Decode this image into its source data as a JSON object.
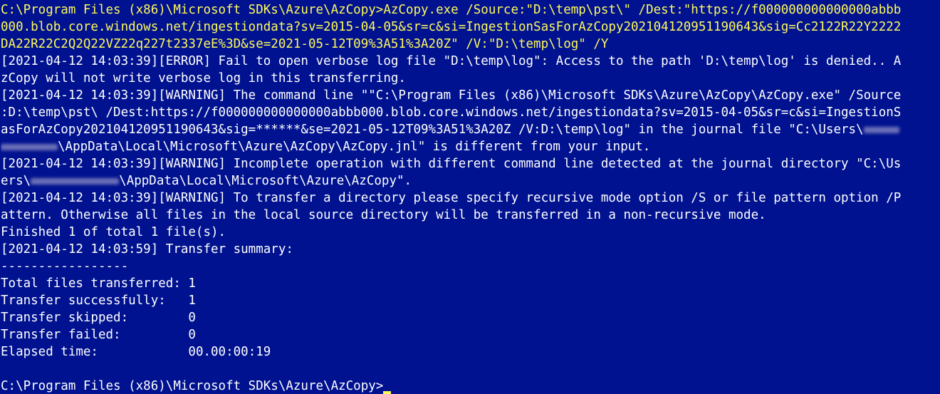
{
  "colors": {
    "background": "#00128f",
    "text": "#ffffff",
    "command": "#fff95c"
  },
  "command": {
    "l1": "C:\\Program Files (x86)\\Microsoft SDKs\\Azure\\AzCopy>AzCopy.exe /Source:\"D:\\temp\\pst\\\" /Dest:\"https://f000000000000000abbb",
    "l2": "000.blob.core.windows.net/ingestiondata?sv=2015-04-05&sr=c&si=IngestionSasForAzCopy202104120951190643&sig=Cc2122R22Y2222",
    "l3": "DA22R22C2Q2Q22VZ22q227t2337eE%3D&se=2021-05-12T09%3A51%3A20Z\" /V:\"D:\\temp\\log\" /Y"
  },
  "output": {
    "error_l1": "[2021-04-12 14:03:39][ERROR] Fail to open verbose log file \"D:\\temp\\log\": Access to the path 'D:\\temp\\log' is denied.. A",
    "error_l2": "zCopy will not write verbose log in this transferring.",
    "warn1_l1": "[2021-04-12 14:03:39][WARNING] The command line \"\"C:\\Program Files (x86)\\Microsoft SDKs\\Azure\\AzCopy\\AzCopy.exe\" /Source",
    "warn1_l2": ":D:\\temp\\pst\\ /Dest:https://f000000000000000abbb000.blob.core.windows.net/ingestiondata?sv=2015-04-05&sr=c&si=IngestionS",
    "warn1_l3": "asForAzCopy202104120951190643&sig=******&se=2021-05-12T09%3A51%3A20Z /V:D:\\temp\\log\" in the journal file \"C:\\Users\\",
    "warn1_l4_rest": "\\AppData\\Local\\Microsoft\\Azure\\AzCopy\\AzCopy.jnl\" is different from your input.",
    "warn2_l1": "[2021-04-12 14:03:39][WARNING] Incomplete operation with different command line detected at the journal directory \"C:\\Us",
    "warn2_l2_prefix": "ers\\",
    "warn2_l2_rest": "\\AppData\\Local\\Microsoft\\Azure\\AzCopy\".",
    "warn3_l1": "[2021-04-12 14:03:39][WARNING] To transfer a directory please specify recursive mode option /S or file pattern option /P",
    "warn3_l2": "attern. Otherwise all files in the local source directory will be transferred in a non-recursive mode.",
    "finished": "Finished 1 of total 1 file(s).",
    "summary_header": "[2021-04-12 14:03:59] Transfer summary:",
    "separator": "-----------------"
  },
  "summary": [
    {
      "label": "Total files transferred: ",
      "value": "1"
    },
    {
      "label": "Transfer successfully:   ",
      "value": "1"
    },
    {
      "label": "Transfer skipped:        ",
      "value": "0"
    },
    {
      "label": "Transfer failed:         ",
      "value": "0"
    },
    {
      "label": "Elapsed time:            ",
      "value": "00.00:00:19"
    }
  ],
  "prompt": "C:\\Program Files (x86)\\Microsoft SDKs\\Azure\\AzCopy>"
}
